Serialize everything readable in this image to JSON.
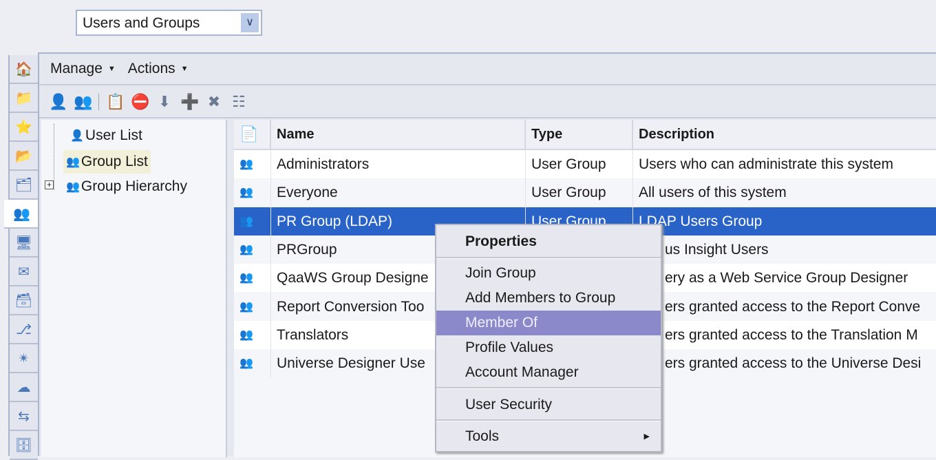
{
  "view_selector": {
    "value": "Users and Groups",
    "icon": "chevron-down-icon"
  },
  "side_tabs": [
    "home-icon",
    "folder-icon",
    "favorites-folder-icon",
    "categories-icon",
    "personal-categories-icon",
    "users-groups-icon",
    "servers-icon",
    "inbox-icon",
    "database-icon",
    "connection-icon",
    "star-icon",
    "server-groups-icon",
    "replication-icon",
    "universe-icon"
  ],
  "menubar": {
    "manage": "Manage",
    "actions": "Actions"
  },
  "toolbar": [
    "new-user-icon",
    "new-group-icon",
    "properties-icon",
    "remove-user-icon",
    "add-members-icon",
    "join-group-icon",
    "delete-icon",
    "hierarchy-icon"
  ],
  "tree": {
    "items": [
      {
        "label": "User List"
      },
      {
        "label": "Group List",
        "selected": true
      },
      {
        "label": "Group Hierarchy",
        "expandable": true
      }
    ]
  },
  "table": {
    "columns": [
      "Name",
      "Type",
      "Description"
    ],
    "rows": [
      {
        "name": "Administrators",
        "type": "User Group",
        "description": "Users who can administrate this system"
      },
      {
        "name": "Everyone",
        "type": "User Group",
        "description": "All users of this system"
      },
      {
        "name": "PR Group (LDAP)",
        "type": "User Group",
        "description": "LDAP Users Group",
        "selected": true
      },
      {
        "name": "PRGroup",
        "type": "",
        "description": "us Insight Users"
      },
      {
        "name": "QaaWS Group Designe",
        "type": "",
        "description": "ery as a Web Service Group Designer"
      },
      {
        "name": "Report Conversion Too",
        "type": "",
        "description": "ers granted access to the Report Conve"
      },
      {
        "name": "Translators",
        "type": "",
        "description": "ers granted access to the Translation M"
      },
      {
        "name": "Universe Designer Use",
        "type": "",
        "description": "ers granted access to the Universe Desi"
      }
    ]
  },
  "context_menu": {
    "properties": "Properties",
    "join_group": "Join Group",
    "add_members": "Add Members to Group",
    "member_of": "Member Of",
    "profile_values": "Profile Values",
    "account_manager": "Account Manager",
    "user_security": "User Security",
    "tools": "Tools"
  },
  "colors": {
    "selection": "#2a63c8",
    "menu_highlight": "#8c89cb"
  }
}
